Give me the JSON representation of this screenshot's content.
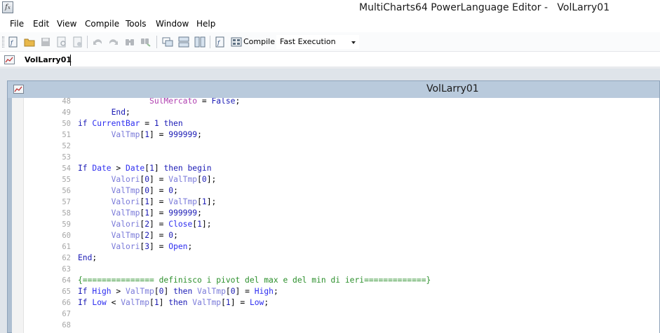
{
  "window": {
    "title": "MultiCharts64 PowerLanguage Editor -   VolLarry01"
  },
  "menu": [
    "File",
    "Edit",
    "View",
    "Compile",
    "Tools",
    "Window",
    "Help"
  ],
  "toolbar": {
    "compile_label": "Compile",
    "execution_mode": "Fast Execution"
  },
  "tab": {
    "label": "VolLarry01"
  },
  "editor": {
    "title": "VolLarry01",
    "lines": [
      {
        "n": "48",
        "segs": [
          {
            "c": "plain",
            "t": "               "
          },
          {
            "c": "mag",
            "t": "SulMercato"
          },
          {
            "c": "plain",
            "t": " = "
          },
          {
            "c": "kw",
            "t": "False"
          },
          {
            "c": "plain",
            "t": ";"
          }
        ]
      },
      {
        "n": "49",
        "segs": [
          {
            "c": "plain",
            "t": "       "
          },
          {
            "c": "kw",
            "t": "End"
          },
          {
            "c": "plain",
            "t": ";"
          }
        ]
      },
      {
        "n": "50",
        "segs": [
          {
            "c": "kw",
            "t": "if "
          },
          {
            "c": "id",
            "t": "CurrentBar"
          },
          {
            "c": "plain",
            "t": " = "
          },
          {
            "c": "lit",
            "t": "1"
          },
          {
            "c": "kw",
            "t": " then"
          }
        ]
      },
      {
        "n": "51",
        "segs": [
          {
            "c": "plain",
            "t": "       "
          },
          {
            "c": "var",
            "t": "ValTmp"
          },
          {
            "c": "plain",
            "t": "["
          },
          {
            "c": "lit",
            "t": "1"
          },
          {
            "c": "plain",
            "t": "] = "
          },
          {
            "c": "lit",
            "t": "999999"
          },
          {
            "c": "plain",
            "t": ";"
          }
        ]
      },
      {
        "n": "52",
        "segs": []
      },
      {
        "n": "53",
        "segs": []
      },
      {
        "n": "54",
        "segs": [
          {
            "c": "kw",
            "t": "If "
          },
          {
            "c": "id",
            "t": "Date"
          },
          {
            "c": "plain",
            "t": " > "
          },
          {
            "c": "id",
            "t": "Date"
          },
          {
            "c": "plain",
            "t": "["
          },
          {
            "c": "lit",
            "t": "1"
          },
          {
            "c": "plain",
            "t": "] "
          },
          {
            "c": "kw",
            "t": "then begin"
          }
        ]
      },
      {
        "n": "55",
        "segs": [
          {
            "c": "plain",
            "t": "       "
          },
          {
            "c": "var",
            "t": "Valori"
          },
          {
            "c": "plain",
            "t": "["
          },
          {
            "c": "lit",
            "t": "0"
          },
          {
            "c": "plain",
            "t": "] = "
          },
          {
            "c": "var",
            "t": "ValTmp"
          },
          {
            "c": "plain",
            "t": "["
          },
          {
            "c": "lit",
            "t": "0"
          },
          {
            "c": "plain",
            "t": "];"
          }
        ]
      },
      {
        "n": "56",
        "segs": [
          {
            "c": "plain",
            "t": "       "
          },
          {
            "c": "var",
            "t": "ValTmp"
          },
          {
            "c": "plain",
            "t": "["
          },
          {
            "c": "lit",
            "t": "0"
          },
          {
            "c": "plain",
            "t": "] = "
          },
          {
            "c": "lit",
            "t": "0"
          },
          {
            "c": "plain",
            "t": ";"
          }
        ]
      },
      {
        "n": "57",
        "segs": [
          {
            "c": "plain",
            "t": "       "
          },
          {
            "c": "var",
            "t": "Valori"
          },
          {
            "c": "plain",
            "t": "["
          },
          {
            "c": "lit",
            "t": "1"
          },
          {
            "c": "plain",
            "t": "] = "
          },
          {
            "c": "var",
            "t": "ValTmp"
          },
          {
            "c": "plain",
            "t": "["
          },
          {
            "c": "lit",
            "t": "1"
          },
          {
            "c": "plain",
            "t": "];"
          }
        ]
      },
      {
        "n": "58",
        "segs": [
          {
            "c": "plain",
            "t": "       "
          },
          {
            "c": "var",
            "t": "ValTmp"
          },
          {
            "c": "plain",
            "t": "["
          },
          {
            "c": "lit",
            "t": "1"
          },
          {
            "c": "plain",
            "t": "] = "
          },
          {
            "c": "lit",
            "t": "999999"
          },
          {
            "c": "plain",
            "t": ";"
          }
        ]
      },
      {
        "n": "59",
        "segs": [
          {
            "c": "plain",
            "t": "       "
          },
          {
            "c": "var",
            "t": "Valori"
          },
          {
            "c": "plain",
            "t": "["
          },
          {
            "c": "lit",
            "t": "2"
          },
          {
            "c": "plain",
            "t": "] = "
          },
          {
            "c": "id",
            "t": "Close"
          },
          {
            "c": "plain",
            "t": "["
          },
          {
            "c": "lit",
            "t": "1"
          },
          {
            "c": "plain",
            "t": "];"
          }
        ]
      },
      {
        "n": "60",
        "segs": [
          {
            "c": "plain",
            "t": "       "
          },
          {
            "c": "var",
            "t": "ValTmp"
          },
          {
            "c": "plain",
            "t": "["
          },
          {
            "c": "lit",
            "t": "2"
          },
          {
            "c": "plain",
            "t": "] = "
          },
          {
            "c": "lit",
            "t": "0"
          },
          {
            "c": "plain",
            "t": ";"
          }
        ]
      },
      {
        "n": "61",
        "segs": [
          {
            "c": "plain",
            "t": "       "
          },
          {
            "c": "var",
            "t": "Valori"
          },
          {
            "c": "plain",
            "t": "["
          },
          {
            "c": "lit",
            "t": "3"
          },
          {
            "c": "plain",
            "t": "] = "
          },
          {
            "c": "id",
            "t": "Open"
          },
          {
            "c": "plain",
            "t": ";"
          }
        ]
      },
      {
        "n": "62",
        "segs": [
          {
            "c": "kw",
            "t": "End"
          },
          {
            "c": "plain",
            "t": ";"
          }
        ]
      },
      {
        "n": "63",
        "segs": []
      },
      {
        "n": "64",
        "segs": [
          {
            "c": "cmt",
            "t": "{=============== definisco i pivot del max e del min di ieri=============}"
          }
        ]
      },
      {
        "n": "65",
        "segs": [
          {
            "c": "kw",
            "t": "If "
          },
          {
            "c": "id",
            "t": "High"
          },
          {
            "c": "plain",
            "t": " > "
          },
          {
            "c": "var",
            "t": "ValTmp"
          },
          {
            "c": "plain",
            "t": "["
          },
          {
            "c": "lit",
            "t": "0"
          },
          {
            "c": "plain",
            "t": "] "
          },
          {
            "c": "kw",
            "t": "then "
          },
          {
            "c": "var",
            "t": "ValTmp"
          },
          {
            "c": "plain",
            "t": "["
          },
          {
            "c": "lit",
            "t": "0"
          },
          {
            "c": "plain",
            "t": "] = "
          },
          {
            "c": "id",
            "t": "High"
          },
          {
            "c": "plain",
            "t": ";"
          }
        ]
      },
      {
        "n": "66",
        "segs": [
          {
            "c": "kw",
            "t": "If "
          },
          {
            "c": "id",
            "t": "Low"
          },
          {
            "c": "plain",
            "t": " < "
          },
          {
            "c": "var",
            "t": "ValTmp"
          },
          {
            "c": "plain",
            "t": "["
          },
          {
            "c": "lit",
            "t": "1"
          },
          {
            "c": "plain",
            "t": "] "
          },
          {
            "c": "kw",
            "t": "then "
          },
          {
            "c": "var",
            "t": "ValTmp"
          },
          {
            "c": "plain",
            "t": "["
          },
          {
            "c": "lit",
            "t": "1"
          },
          {
            "c": "plain",
            "t": "] = "
          },
          {
            "c": "id",
            "t": "Low"
          },
          {
            "c": "plain",
            "t": ";"
          }
        ]
      },
      {
        "n": "67",
        "segs": []
      },
      {
        "n": "68",
        "segs": []
      }
    ]
  }
}
